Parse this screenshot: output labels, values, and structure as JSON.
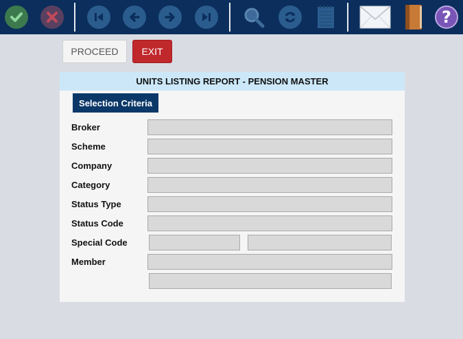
{
  "toolbar": {
    "icons": [
      "check-icon",
      "close-icon",
      "first-icon",
      "back-icon",
      "forward-icon",
      "last-icon",
      "search-icon",
      "refresh-icon",
      "notepad-icon",
      "mail-icon",
      "book-icon",
      "help-icon"
    ],
    "help_glyph": "?"
  },
  "actions": {
    "proceed_label": "PROCEED",
    "exit_label": "EXIT"
  },
  "report": {
    "title": "UNITS LISTING REPORT - PENSION MASTER",
    "criteria_tab": "Selection Criteria",
    "fields": {
      "broker": {
        "label": "Broker",
        "value": ""
      },
      "scheme": {
        "label": "Scheme",
        "value": ""
      },
      "company": {
        "label": "Company",
        "value": ""
      },
      "category": {
        "label": "Category",
        "value": ""
      },
      "status_type": {
        "label": "Status Type",
        "value": ""
      },
      "status_code": {
        "label": "Status Code",
        "value": ""
      },
      "special_code": {
        "label": "Special Code",
        "value_from": "",
        "value_to": ""
      },
      "member": {
        "label": "Member",
        "value": "",
        "value_extra": ""
      }
    }
  },
  "colors": {
    "toolbar_bg": "#0b2e5c",
    "page_bg": "#d9dde3",
    "title_bg": "#cce8f8",
    "tab_bg": "#0b3868",
    "exit_bg": "#c0282c"
  }
}
